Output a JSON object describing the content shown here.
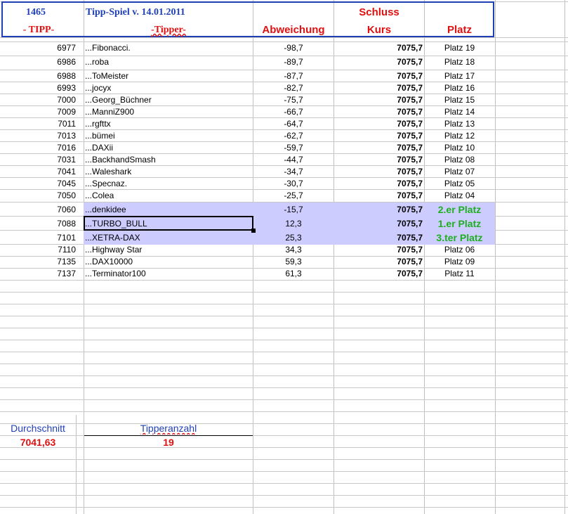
{
  "header": {
    "tipp_number": "1465",
    "title": "Tipp-Spiel v. 14.01.2011",
    "schluss": "Schluss",
    "col_tipp": "- TIPP-",
    "col_tipper": "-Tipper-",
    "col_abweichung": "Abweichung",
    "col_kurs": "Kurs",
    "col_platz": "Platz"
  },
  "rows": [
    {
      "tipp": "6977",
      "tipper": "...Fibonacci.",
      "abw": "-98,7",
      "kurs": "7075,7",
      "platz": "Platz 19"
    },
    {
      "tipp": "6986",
      "tipper": "...roba",
      "abw": "-89,7",
      "kurs": "7075,7",
      "platz": "Platz 18"
    },
    {
      "tipp": "6988",
      "tipper": "...ToMeister",
      "abw": "-87,7",
      "kurs": "7075,7",
      "platz": "Platz 17"
    },
    {
      "tipp": "6993",
      "tipper": "...jocyx",
      "abw": "-82,7",
      "kurs": "7075,7",
      "platz": "Platz 16"
    },
    {
      "tipp": "7000",
      "tipper": "...Georg_Büchner",
      "abw": "-75,7",
      "kurs": "7075,7",
      "platz": "Platz 15"
    },
    {
      "tipp": "7009",
      "tipper": "...ManniZ900",
      "abw": "-66,7",
      "kurs": "7075,7",
      "platz": "Platz 14"
    },
    {
      "tipp": "7011",
      "tipper": "...rgfttx",
      "abw": "-64,7",
      "kurs": "7075,7",
      "platz": "Platz 13"
    },
    {
      "tipp": "7013",
      "tipper": "...bümei",
      "abw": "-62,7",
      "kurs": "7075,7",
      "platz": "Platz 12"
    },
    {
      "tipp": "7016",
      "tipper": "...DAXii",
      "abw": "-59,7",
      "kurs": "7075,7",
      "platz": "Platz 10"
    },
    {
      "tipp": "7031",
      "tipper": "...BackhandSmash",
      "abw": "-44,7",
      "kurs": "7075,7",
      "platz": "Platz 08"
    },
    {
      "tipp": "7041",
      "tipper": "...Waleshark",
      "abw": "-34,7",
      "kurs": "7075,7",
      "platz": "Platz 07"
    },
    {
      "tipp": "7045",
      "tipper": "...Specnaz.",
      "abw": "-30,7",
      "kurs": "7075,7",
      "platz": "Platz 05"
    },
    {
      "tipp": "7050",
      "tipper": "...Colea",
      "abw": "-25,7",
      "kurs": "7075,7",
      "platz": "Platz 04"
    },
    {
      "tipp": "7060",
      "tipper": "...denkidee",
      "abw": "-15,7",
      "kurs": "7075,7",
      "platz": "2.er Platz"
    },
    {
      "tipp": "7088",
      "tipper": "...TURBO_BULL",
      "abw": "12,3",
      "kurs": "7075,7",
      "platz": "1.er Platz"
    },
    {
      "tipp": "7101",
      "tipper": "...XETRA-DAX",
      "abw": "25,3",
      "kurs": "7075,7",
      "platz": "3.ter Platz"
    },
    {
      "tipp": "7110",
      "tipper": "...Highway Star",
      "abw": "34,3",
      "kurs": "7075,7",
      "platz": "Platz 06"
    },
    {
      "tipp": "7135",
      "tipper": "...DAX10000",
      "abw": "59,3",
      "kurs": "7075,7",
      "platz": "Platz 09"
    },
    {
      "tipp": "7137",
      "tipper": "...Terminator100",
      "abw": "61,3",
      "kurs": "7075,7",
      "platz": "Platz 11"
    }
  ],
  "summary": {
    "durchschnitt_label": "Durchschnitt",
    "durchschnitt_value": "7041,63",
    "tipperanzahl_label": "Tipperanzahl",
    "tipperanzahl_value": "19"
  },
  "colors": {
    "header_blue": "#1f3fb4",
    "header_red": "#e01010",
    "winner_green": "#1fae1f",
    "highlight": "#ccccff",
    "summary_blue": "#1f3fb4"
  }
}
